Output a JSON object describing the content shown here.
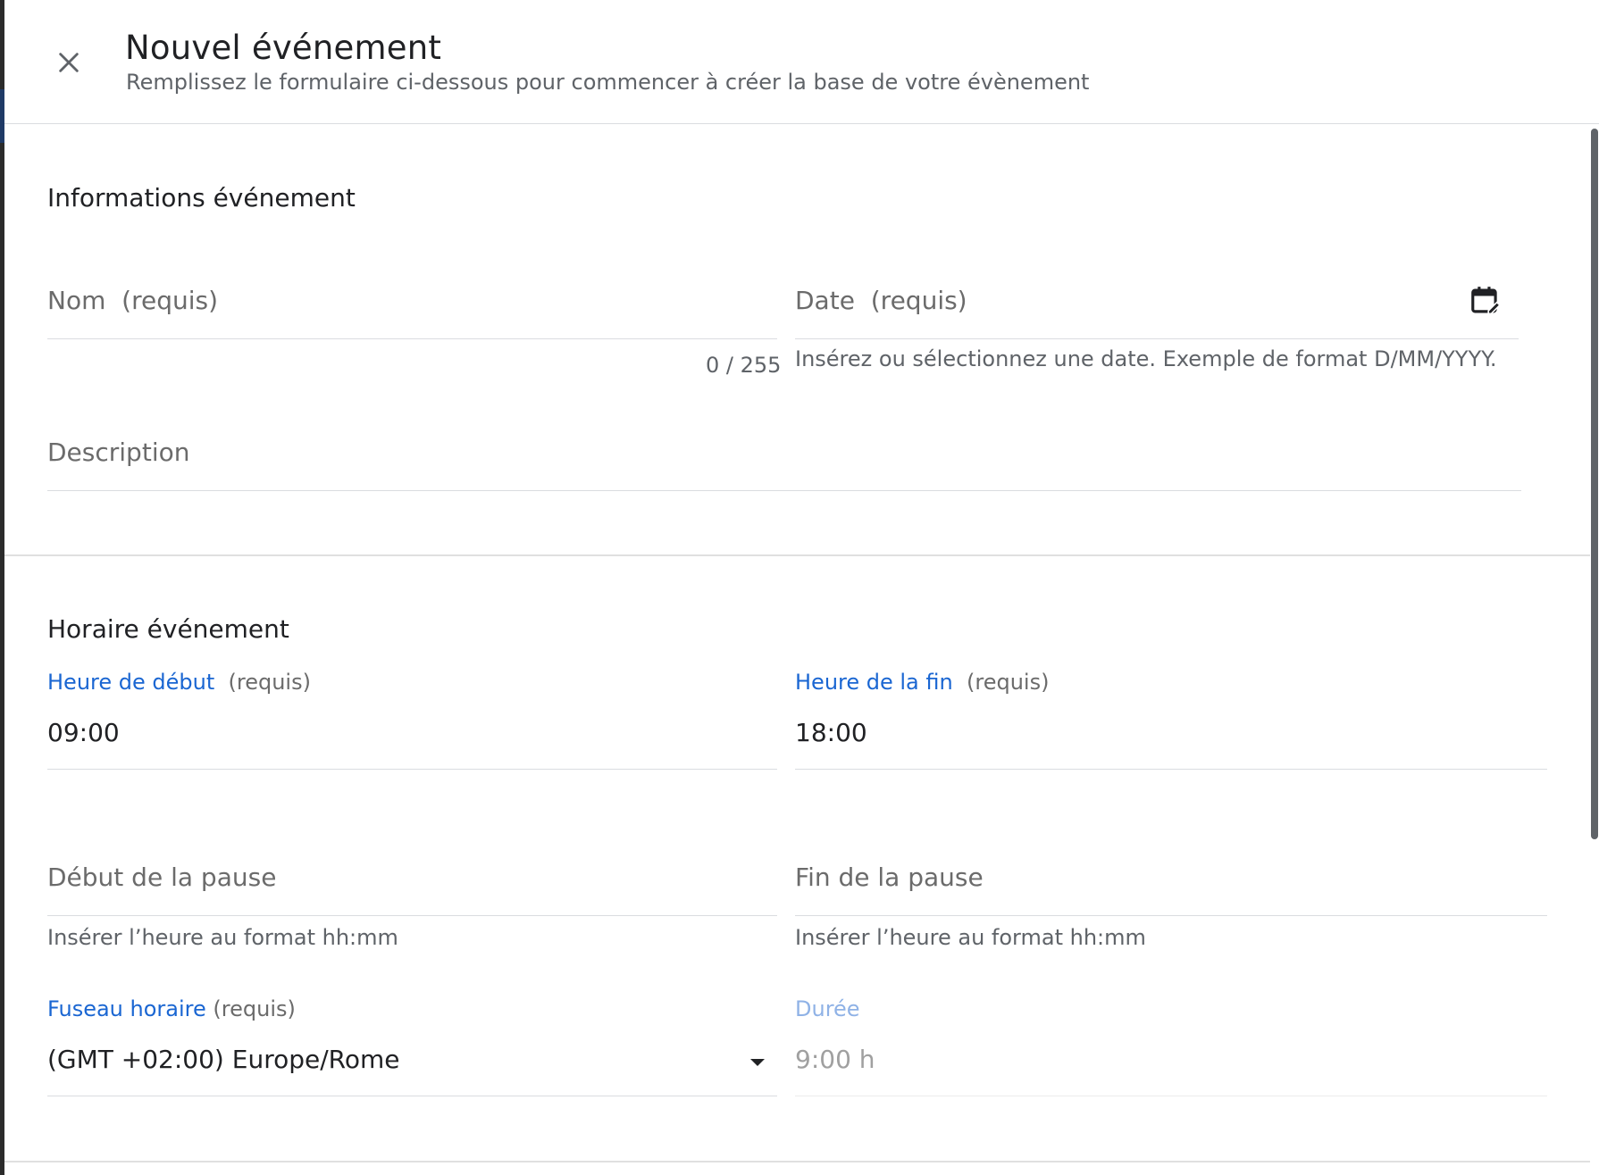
{
  "header": {
    "title": "Nouvel événement",
    "subtitle": "Remplissez le formulaire ci-dessous pour commencer à créer la base de votre évènement"
  },
  "sections": {
    "info": {
      "title": "Informations événement",
      "name": {
        "label": "Nom",
        "required": "(requis)",
        "value": "",
        "counter": "0 / 255"
      },
      "date": {
        "label": "Date",
        "required": "(requis)",
        "value": "",
        "hint": "Insérez ou sélectionnez une date. Exemple de format D/MM/YYYY.",
        "icon": "calendar-edit-icon"
      },
      "description": {
        "label": "Description",
        "value": ""
      }
    },
    "schedule": {
      "title": "Horaire événement",
      "start": {
        "label": "Heure de début",
        "required": "(requis)",
        "value": "09:00"
      },
      "end": {
        "label": "Heure de la fin",
        "required": "(requis)",
        "value": "18:00"
      },
      "break_start": {
        "label": "Début de la pause",
        "value": "",
        "hint": "Insérer l’heure au format hh:mm"
      },
      "break_end": {
        "label": "Fin de la pause",
        "value": "",
        "hint": "Insérer l’heure au format hh:mm"
      },
      "timezone": {
        "label": "Fuseau horaire",
        "required": "(requis)",
        "value": "(GMT +02:00) Europe/Rome",
        "icon": "dropdown-arrow-icon"
      },
      "duration": {
        "label": "Durée",
        "value": "9:00 h"
      }
    }
  },
  "colors": {
    "accent": "#1a66d2",
    "accent_disabled": "#8fb2e6",
    "text": "#202124",
    "muted_text": "#6b6b6b",
    "divider": "#dadce0"
  }
}
